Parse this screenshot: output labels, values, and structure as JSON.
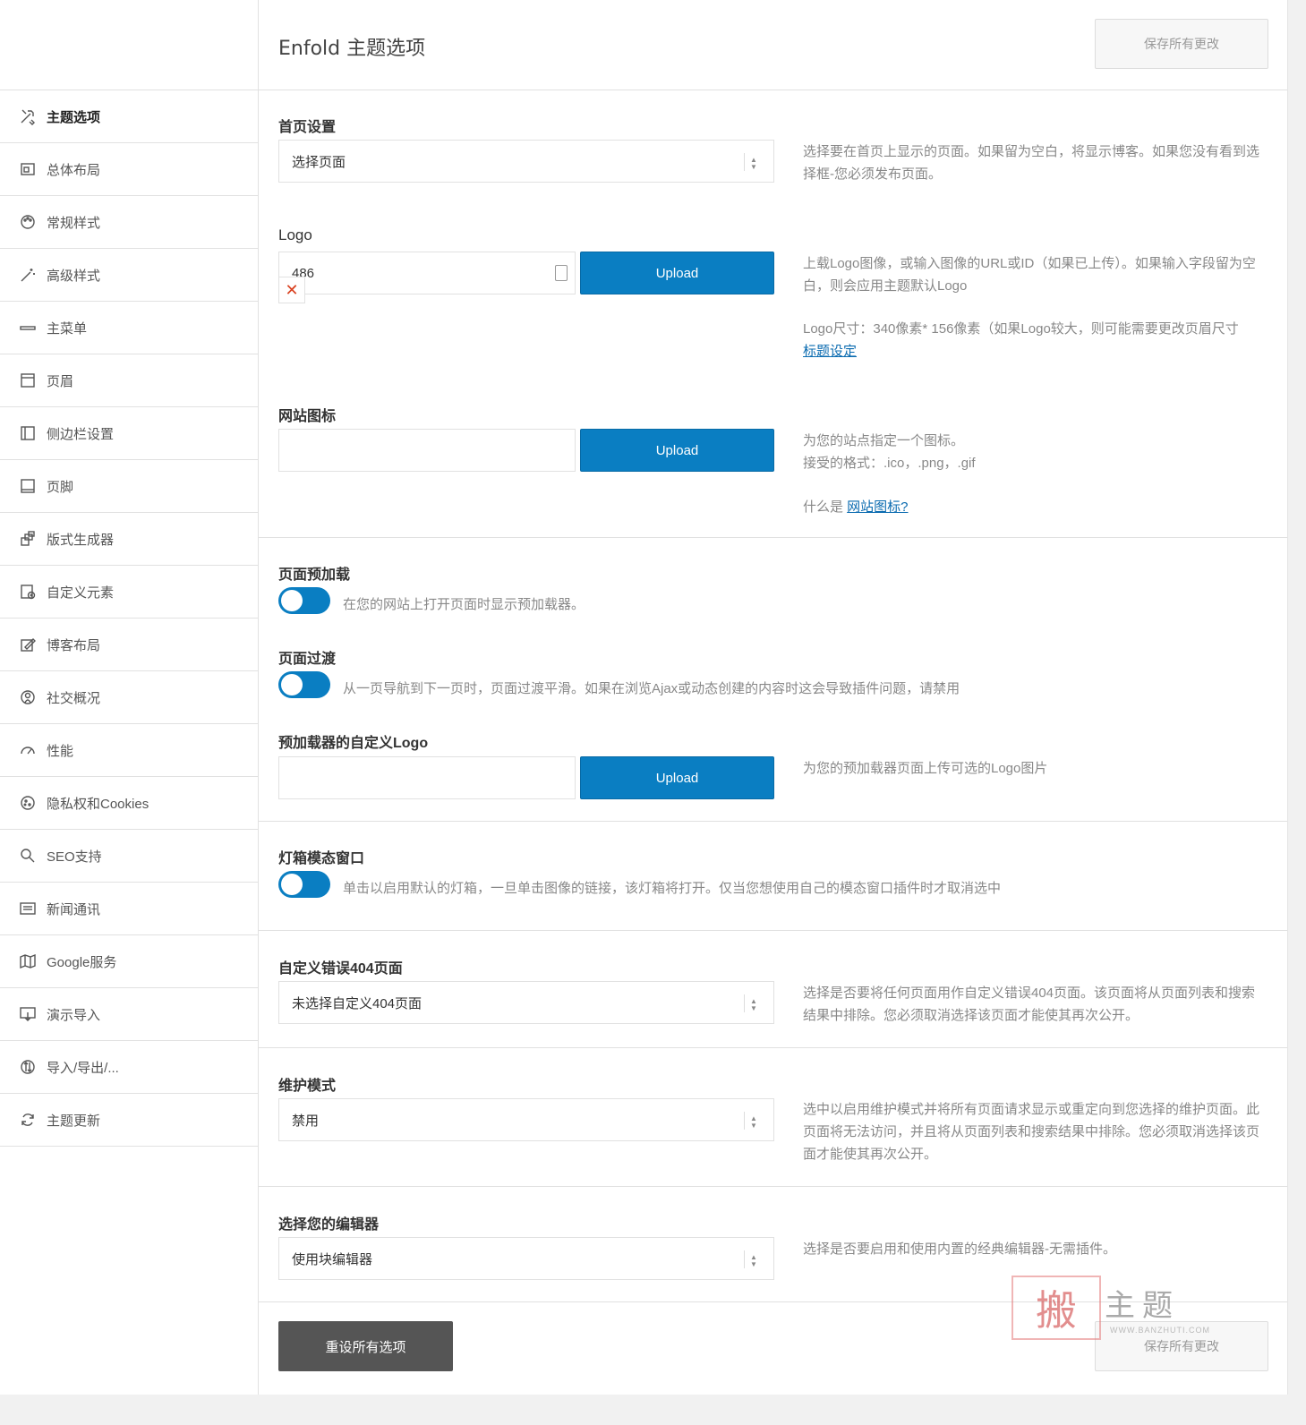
{
  "page_title": "Enfold 主题选项",
  "save_all_label": "保存所有更改",
  "reset_all_label": "重设所有选项",
  "sidebar": {
    "items": [
      {
        "label": "主题选项",
        "icon": "tools-icon",
        "active": true
      },
      {
        "label": "总体布局",
        "icon": "layout-icon"
      },
      {
        "label": "常规样式",
        "icon": "palette-icon"
      },
      {
        "label": "高级样式",
        "icon": "magic-wand-icon"
      },
      {
        "label": "主菜单",
        "icon": "menu-bar-icon"
      },
      {
        "label": "页眉",
        "icon": "header-icon"
      },
      {
        "label": "侧边栏设置",
        "icon": "sidebar-icon"
      },
      {
        "label": "页脚",
        "icon": "footer-icon"
      },
      {
        "label": "版式生成器",
        "icon": "layout-builder-icon"
      },
      {
        "label": "自定义元素",
        "icon": "custom-element-icon"
      },
      {
        "label": "博客布局",
        "icon": "blog-icon"
      },
      {
        "label": "社交概况",
        "icon": "social-icon"
      },
      {
        "label": "性能",
        "icon": "gauge-icon"
      },
      {
        "label": "隐私权和Cookies",
        "icon": "cookie-icon"
      },
      {
        "label": "SEO支持",
        "icon": "search-icon"
      },
      {
        "label": "新闻通讯",
        "icon": "newsletter-icon"
      },
      {
        "label": "Google服务",
        "icon": "map-icon"
      },
      {
        "label": "演示导入",
        "icon": "import-icon"
      },
      {
        "label": "导入/导出/...",
        "icon": "import-export-icon"
      },
      {
        "label": "主题更新",
        "icon": "refresh-icon"
      }
    ]
  },
  "frontpage": {
    "label": "首页设置",
    "value": "选择页面",
    "desc": "选择要在首页上显示的页面。如果留为空白，将显示博客。如果您没有看到选择框-您必须发布页面。"
  },
  "logo": {
    "label": "Logo",
    "value": "486",
    "upload_label": "Upload",
    "clear_symbol": "✕",
    "desc1": "上载Logo图像，或输入图像的URL或ID（如果已上传）。如果输入字段留为空白，则会应用主题默认Logo",
    "desc2": "Logo尺寸：340像素* 156像素（如果Logo较大，则可能需要更改页眉尺寸",
    "link": "标题设定"
  },
  "favicon": {
    "label": "网站图标",
    "value": "",
    "upload_label": "Upload",
    "desc1": "为您的站点指定一个图标。",
    "desc2": "接受的格式：.ico，.png，.gif",
    "desc3_prefix": "什么是 ",
    "link": "网站图标?"
  },
  "preloader": {
    "label": "页面预加载",
    "enabled": true,
    "desc": "在您的网站上打开页面时显示预加载器。"
  },
  "transition": {
    "label": "页面过渡",
    "enabled": true,
    "desc": "从一页导航到下一页时，页面过渡平滑。如果在浏览Ajax或动态创建的内容时这会导致插件问题，请禁用"
  },
  "preloader_logo": {
    "label": "预加载器的自定义Logo",
    "value": "",
    "upload_label": "Upload",
    "desc": "为您的预加载器页面上传可选的Logo图片"
  },
  "lightbox": {
    "label": "灯箱模态窗口",
    "enabled": true,
    "desc": "单击以启用默认的灯箱，一旦单击图像的链接，该灯箱将打开。仅当您想使用自己的模态窗口插件时才取消选中"
  },
  "error404": {
    "label": "自定义错误404页面",
    "value": "未选择自定义404页面",
    "desc": "选择是否要将任何页面用作自定义错误404页面。该页面将从页面列表和搜索结果中排除。您必须取消选择该页面才能使其再次公开。"
  },
  "maintenance": {
    "label": "维护模式",
    "value": "禁用",
    "desc": "选中以启用维护模式并将所有页面请求显示或重定向到您选择的维护页面。此页面将无法访问，并且将从页面列表和搜索结果中排除。您必须取消选择该页面才能使其再次公开。"
  },
  "editor": {
    "label": "选择您的编辑器",
    "value": "使用块编辑器",
    "desc": "选择是否要启用和使用内置的经典编辑器-无需插件。"
  },
  "watermark": {
    "mark": "搬",
    "text": "主题",
    "url": "WWW.BANZHUTI.COM"
  },
  "colors": {
    "accent": "#0a7ec2",
    "reset_button": "#555555",
    "clear_icon": "#d9401f"
  }
}
